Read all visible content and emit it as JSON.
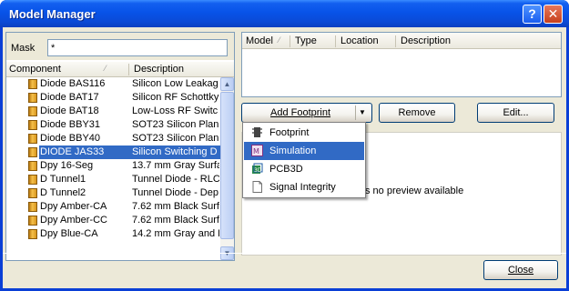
{
  "window": {
    "title": "Model Manager",
    "help_label": "?",
    "close_label": "✕"
  },
  "mask": {
    "label": "Mask",
    "value": "*"
  },
  "component_list": {
    "columns": [
      "Component",
      "Description"
    ],
    "rows": [
      {
        "name": "Diode BAS116",
        "desc": "Silicon Low Leakag"
      },
      {
        "name": "Diode BAT17",
        "desc": "Silicon RF Schottky"
      },
      {
        "name": "Diode BAT18",
        "desc": "Low-Loss RF Switc"
      },
      {
        "name": "Diode BBY31",
        "desc": "SOT23 Silicon Plan"
      },
      {
        "name": "Diode BBY40",
        "desc": "SOT23 Silicon Plan"
      },
      {
        "name": "DIODE JAS33",
        "desc": "Silicon Switching D"
      },
      {
        "name": "Dpy 16-Seg",
        "desc": "13.7 mm Gray Surfa"
      },
      {
        "name": "D Tunnel1",
        "desc": "Tunnel Diode - RLC"
      },
      {
        "name": "D Tunnel2",
        "desc": "Tunnel Diode - Dep"
      },
      {
        "name": "Dpy Amber-CA",
        "desc": "7.62 mm Black Surf"
      },
      {
        "name": "Dpy Amber-CC",
        "desc": "7.62 mm Black Surf"
      },
      {
        "name": "Dpy Blue-CA",
        "desc": "14.2 mm Gray and R"
      }
    ],
    "selected_index": 5
  },
  "model_list": {
    "columns": [
      "Model",
      "Type",
      "Location",
      "Description"
    ]
  },
  "buttons": {
    "add_footprint": "Add Footprint",
    "remove": "Remove",
    "edit": "Edit...",
    "close": "Close"
  },
  "menu": {
    "items": [
      {
        "label": "Footprint",
        "icon": "footprint-icon"
      },
      {
        "label": "Simulation",
        "icon": "simulation-icon"
      },
      {
        "label": "PCB3D",
        "icon": "pcb3d-icon"
      },
      {
        "label": "Signal Integrity",
        "icon": "signal-integrity-icon"
      }
    ],
    "active_index": 1
  },
  "preview": {
    "text": "s no preview available"
  }
}
